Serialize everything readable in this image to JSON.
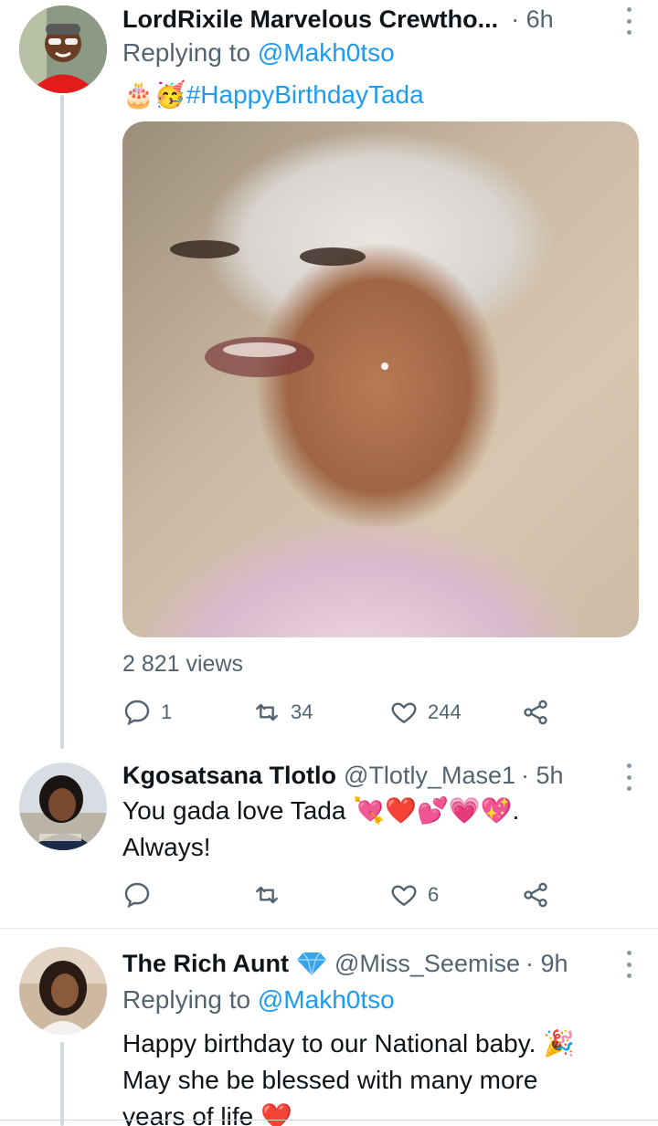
{
  "tweets": [
    {
      "name": "LordRixile Marvelous Crewtho...",
      "time": "· 6h",
      "replying_prefix": "Replying to",
      "replying_to": "@Makh0tso",
      "emoji_prefix": "🎂🥳",
      "hashtag": "#HappyBirthdayTada",
      "views": "2 821 views",
      "replies": "1",
      "retweets": "34",
      "likes": "244"
    },
    {
      "name": "Kgosatsana Tlotlo",
      "handle": "@Tlotly_Mase1",
      "time": "· 5h",
      "text_line1": "You gada love Tada",
      "emoji_line1": "💘❤️💕💗💖",
      "text_line1_end": ".",
      "text_line2": "Always!",
      "replies": "",
      "retweets": "",
      "likes": "6"
    },
    {
      "name": "The Rich Aunt",
      "badge_icon": "gem-icon",
      "handle": "@Miss_Seemise",
      "time": "· 9h",
      "replying_prefix": "Replying to",
      "replying_to": "@Makh0tso",
      "text_line1": "Happy birthday to our National baby.",
      "emoji_line1": "🎉",
      "text_line2": "May she be blessed with many more",
      "text_line3": "years of life",
      "emoji_line3": "❤️"
    }
  ],
  "colors": {
    "accent": "#1d9bf0",
    "secondary_text": "#536471",
    "thread_line": "#cfd9de"
  }
}
